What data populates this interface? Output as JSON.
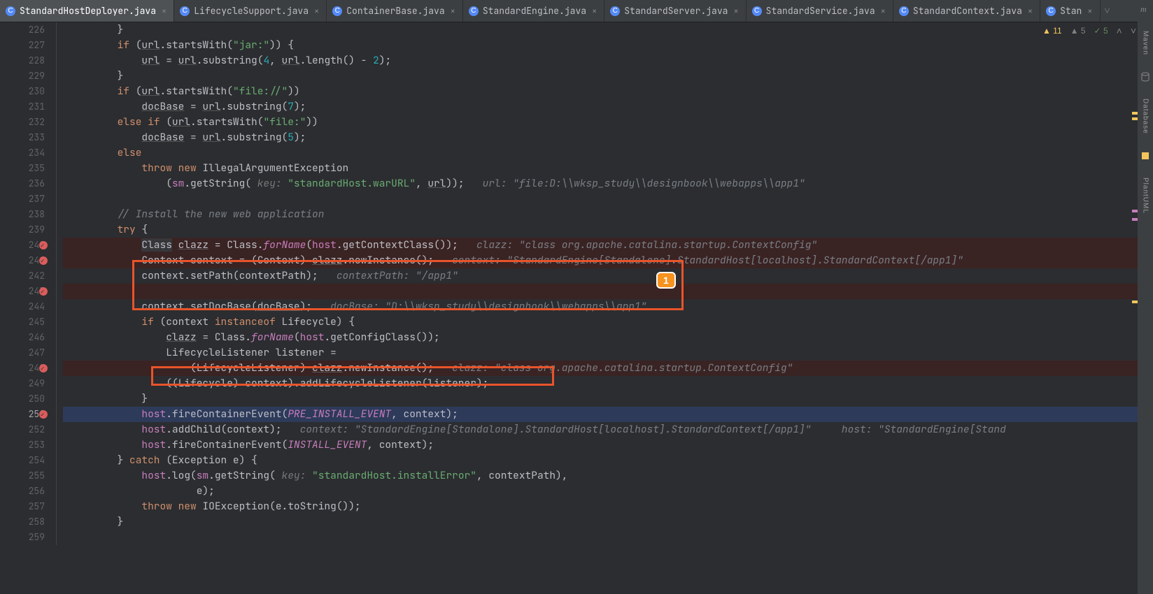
{
  "tabs": [
    {
      "label": "StandardHostDeployer.java",
      "active": true
    },
    {
      "label": "LifecycleSupport.java",
      "active": false
    },
    {
      "label": "ContainerBase.java",
      "active": false
    },
    {
      "label": "StandardEngine.java",
      "active": false
    },
    {
      "label": "StandardServer.java",
      "active": false
    },
    {
      "label": "StandardService.java",
      "active": false
    },
    {
      "label": "StandardContext.java",
      "active": false
    },
    {
      "label": "Stan",
      "active": false
    }
  ],
  "lineStart": 226,
  "lineEnd": 259,
  "currentLine": 251,
  "breakpointLines": [
    240,
    241,
    243,
    248,
    251
  ],
  "inspection": {
    "warn": "11",
    "weak": "5",
    "typo": "5"
  },
  "rightTools": [
    "Maven",
    "Database",
    "PlantUML"
  ],
  "annotation": {
    "badge": "1"
  },
  "code": [
    {
      "n": 226,
      "html": "        }"
    },
    {
      "n": 227,
      "html": "        <span class='kw'>if</span> (<span class='underline'>url</span>.startsWith(<span class='str'>\"jar:\"</span>)) {"
    },
    {
      "n": 228,
      "html": "            <span class='underline'>url</span> = <span class='underline'>url</span>.substring(<span class='num'>4</span>, <span class='underline'>url</span>.length() - <span class='num'>2</span>);"
    },
    {
      "n": 229,
      "html": "        }"
    },
    {
      "n": 230,
      "html": "        <span class='kw'>if</span> (<span class='underline'>url</span>.startsWith(<span class='str'>\"file://\"</span>))"
    },
    {
      "n": 231,
      "html": "            <span class='underline'>docBase</span> = <span class='underline'>url</span>.substring(<span class='num'>7</span>);"
    },
    {
      "n": 232,
      "html": "        <span class='kw'>else if</span> (<span class='underline'>url</span>.startsWith(<span class='str'>\"file:\"</span>))"
    },
    {
      "n": 233,
      "html": "            <span class='underline'>docBase</span> = <span class='underline'>url</span>.substring(<span class='num'>5</span>);"
    },
    {
      "n": 234,
      "html": "        <span class='kw'>else</span>"
    },
    {
      "n": 235,
      "html": "            <span class='kw'>throw new</span> IllegalArgumentException"
    },
    {
      "n": 236,
      "html": "                (<span class='field'>sm</span>.getString( <span class='cmt-hint'>key:</span> <span class='str'>\"standardHost.warURL\"</span>, <span class='underline'>url</span>));   <span class='cmt'>url: \"file:D:\\\\wksp_study\\\\designbook\\\\webapps\\\\app1\"</span>"
    },
    {
      "n": 237,
      "html": ""
    },
    {
      "n": 238,
      "html": "        <span class='cmt'>// Install the new web application</span>"
    },
    {
      "n": 239,
      "html": "        <span class='kw'>try</span> {"
    },
    {
      "n": 240,
      "html": "            <span style='background:#37373a'>Class</span> <span class='underline'>clazz</span> = Class.<span class='static'>forName</span>(<span class='field'>host</span>.getContextClass());   <span class='cmt'>clazz: \"class org.apache.catalina.startup.ContextConfig\"</span>"
    },
    {
      "n": 241,
      "html": "            Context context = (Context) <span class='underline'>clazz</span>.newInstance();   <span class='cmt'>context: \"StandardEngine[Standalone].StandardHost[localhost].StandardContext[/app1]\"</span>"
    },
    {
      "n": 242,
      "html": "            context.setPath(contextPath);   <span class='cmt'>contextPath: \"/app1\"</span>"
    },
    {
      "n": 243,
      "html": ""
    },
    {
      "n": 244,
      "html": "            context.setDocBase(<span class='underline'>docBase</span>);   <span class='cmt'>docBase: \"D:\\\\wksp_study\\\\designbook\\\\webapps\\\\app1\"</span>"
    },
    {
      "n": 245,
      "html": "            <span class='kw'>if</span> (context <span class='kw'>instanceof</span> Lifecycle) {"
    },
    {
      "n": 246,
      "html": "                <span class='underline'>clazz</span> = Class.<span class='static'>forName</span>(<span class='field'>host</span>.getConfigClass());"
    },
    {
      "n": 247,
      "html": "                LifecycleListener listener ="
    },
    {
      "n": 248,
      "html": "                    (LifecycleListener) <span class='underline'>clazz</span>.newInstance();   <span class='cmt'>clazz: \"class org.apache.catalina.startup.ContextConfig\"</span>"
    },
    {
      "n": 249,
      "html": "                ((Lifecycle) context).addLifecycleListener(listener);"
    },
    {
      "n": 250,
      "html": "            }"
    },
    {
      "n": 251,
      "html": "            <span class='field'>host</span>.fireContainerEvent(<span class='static'>PRE_INSTALL_EVENT</span>, context);"
    },
    {
      "n": 252,
      "html": "            <span class='field'>host</span>.addChild(context);   <span class='cmt'>context: \"StandardEngine[Standalone].StandardHost[localhost].StandardContext[/app1]\"     host: \"StandardEngine[Stand</span>"
    },
    {
      "n": 253,
      "html": "            <span class='field'>host</span>.fireContainerEvent(<span class='static'>INSTALL_EVENT</span>, context);"
    },
    {
      "n": 254,
      "html": "        } <span class='kw'>catch</span> (Exception e) {"
    },
    {
      "n": 255,
      "html": "            <span class='field'>host</span>.log(<span class='field'>sm</span>.getString( <span class='cmt-hint'>key:</span> <span class='str'>\"standardHost.installError\"</span>, contextPath),"
    },
    {
      "n": 256,
      "html": "                     e);"
    },
    {
      "n": 257,
      "html": "            <span class='kw'>throw new</span> IOException(e.toString());"
    },
    {
      "n": 258,
      "html": "        }"
    },
    {
      "n": 259,
      "html": ""
    }
  ]
}
